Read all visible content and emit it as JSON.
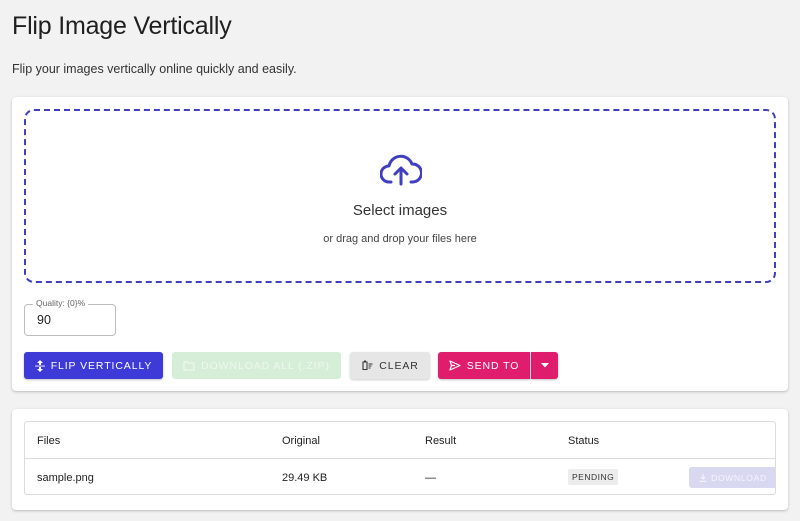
{
  "page": {
    "title": "Flip Image Vertically",
    "subtitle": "Flip your images vertically online quickly and easily."
  },
  "upload": {
    "icon": "cloud-upload-icon",
    "title": "Select images",
    "subtitle": "or drag and drop your files here",
    "accent_color": "#3f3fbf"
  },
  "quality": {
    "label": "Quality: {0}%",
    "value": "90"
  },
  "actions": {
    "flip_label": "Flip Vertically",
    "download_all_label": "Download All (.zip)",
    "clear_label": "Clear",
    "send_to_label": "Send To",
    "colors": {
      "flip": "#3d3ad8",
      "download_all_disabled": "#d6eed8",
      "clear": "#e6e6e6",
      "send_to": "#e01d6d"
    }
  },
  "files_table": {
    "columns": [
      "Files",
      "Original",
      "Result",
      "Status"
    ],
    "rows": [
      {
        "file": "sample.png",
        "original": "29.49 KB",
        "result": "—",
        "status": "PENDING",
        "download_label": "Download"
      }
    ]
  }
}
